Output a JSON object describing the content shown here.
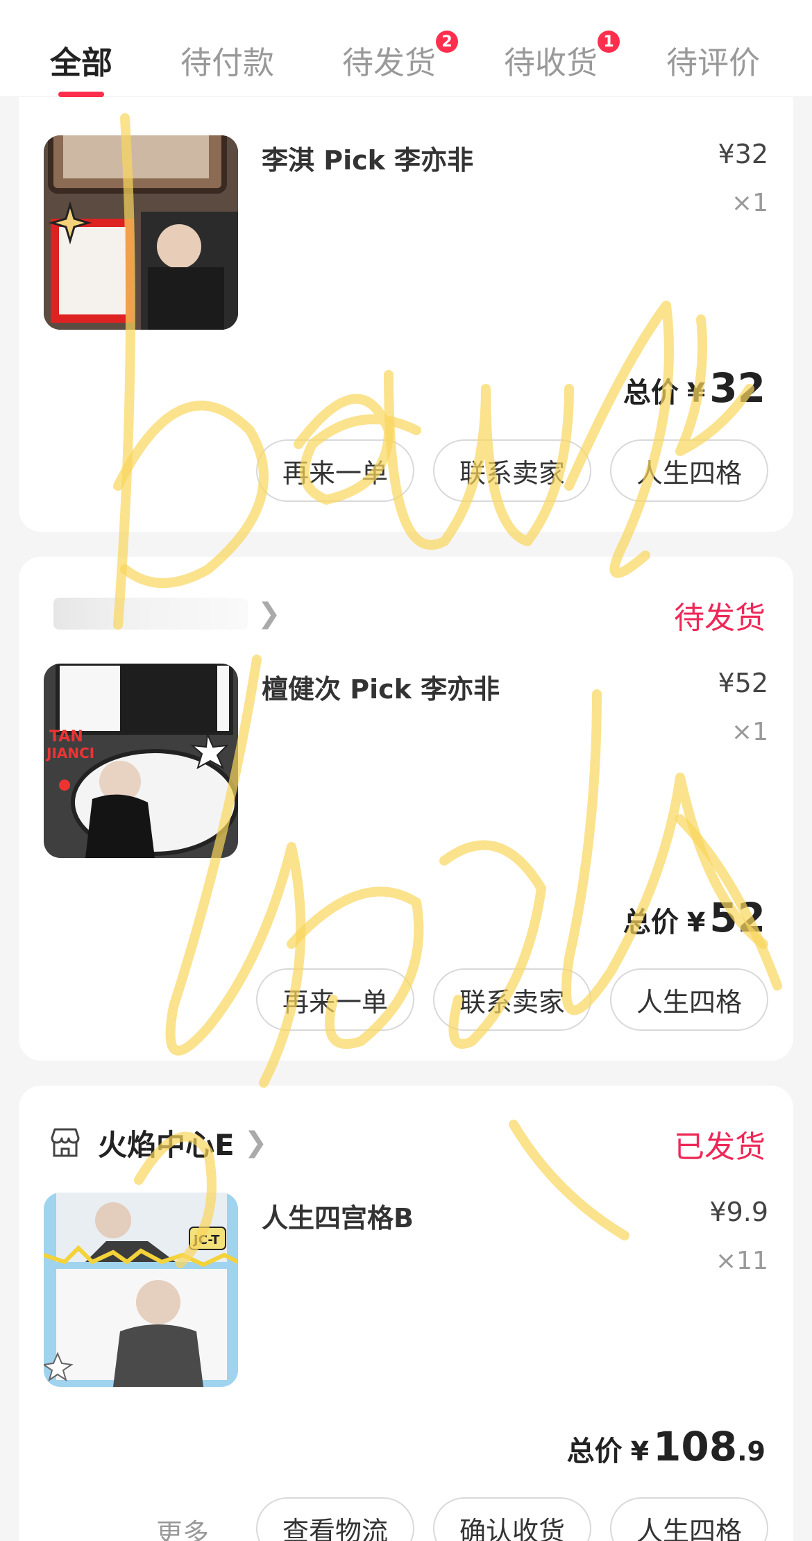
{
  "tabs": [
    {
      "label": "全部",
      "badge": ""
    },
    {
      "label": "待付款",
      "badge": ""
    },
    {
      "label": "待发货",
      "badge": "2"
    },
    {
      "label": "待收货",
      "badge": "1"
    },
    {
      "label": "待评价",
      "badge": ""
    }
  ],
  "orders": [
    {
      "item_title": "李淇 Pick 李亦非",
      "price": "¥32",
      "qty": "×1",
      "total_label": "总价",
      "total_currency": "¥",
      "total_int": "32",
      "total_dec": "",
      "buttons": [
        "再来一单",
        "联系卖家",
        "人生四格"
      ]
    },
    {
      "status": "待发货",
      "item_title": "檀健次 Pick 李亦非",
      "price": "¥52",
      "qty": "×1",
      "total_label": "总价",
      "total_currency": "¥",
      "total_int": "52",
      "total_dec": "",
      "buttons": [
        "再来一单",
        "联系卖家",
        "人生四格"
      ]
    },
    {
      "shop_name": "火焰中心E",
      "status": "已发货",
      "item_title": "人生四宫格B",
      "price": "¥9.9",
      "qty": "×11",
      "total_label": "总价",
      "total_currency": "¥",
      "total_int": "108",
      "total_dec": ".9",
      "more": "更多",
      "buttons": [
        "查看物流",
        "确认收货",
        "人生四格"
      ]
    }
  ],
  "colors": {
    "accent": "#ff2e4d",
    "status": "#ee2857",
    "scribble": "#f9d65c"
  },
  "icons": [
    "shop-icon",
    "chevron-right-icon"
  ]
}
